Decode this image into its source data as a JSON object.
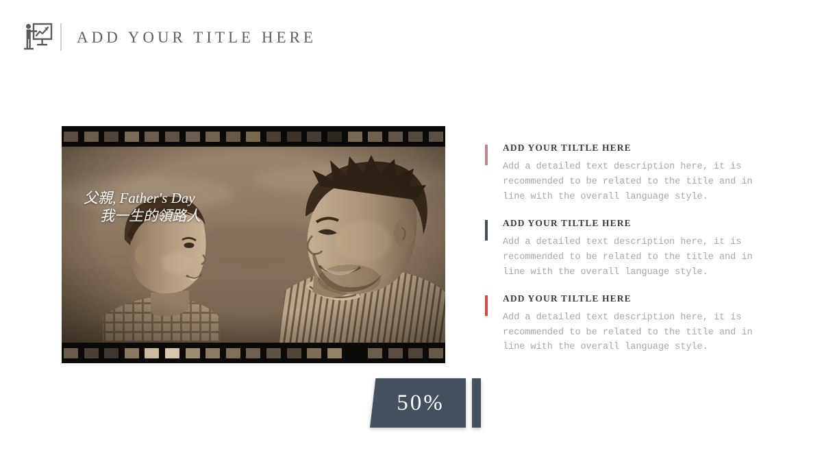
{
  "header": {
    "icon": "presenter-chart-icon",
    "title": "ADD YOUR TITLE HERE"
  },
  "media": {
    "name": "filmstrip-photo",
    "alt": "Sepia photo of a father and young son facing each other on a beach",
    "caption_line1": "父親, Father's Day",
    "caption_line2": "我一生的領路人",
    "sprocket_count": 19,
    "film_color": "#0b0a09",
    "photo_tone": "#8a7c6c"
  },
  "percent_badge": {
    "value": "50%",
    "color": "#44505e"
  },
  "content_blocks": [
    {
      "heading": "ADD YOUR TILTLE HERE",
      "body": "Add a detailed text description here, it is recommended to be related to the title and in line with the overall language style.",
      "accent_color": "#b6878c"
    },
    {
      "heading": "ADD YOUR TILTLE HERE",
      "body": "Add a detailed text description here, it is recommended to be related to the title and in line with the overall language style.",
      "accent_color": "#454f5b"
    },
    {
      "heading": "ADD YOUR TILTLE HERE",
      "body": "Add a detailed text description here, it is recommended to be related to the title and in line with the overall language style.",
      "accent_color": "#d8464a"
    }
  ]
}
